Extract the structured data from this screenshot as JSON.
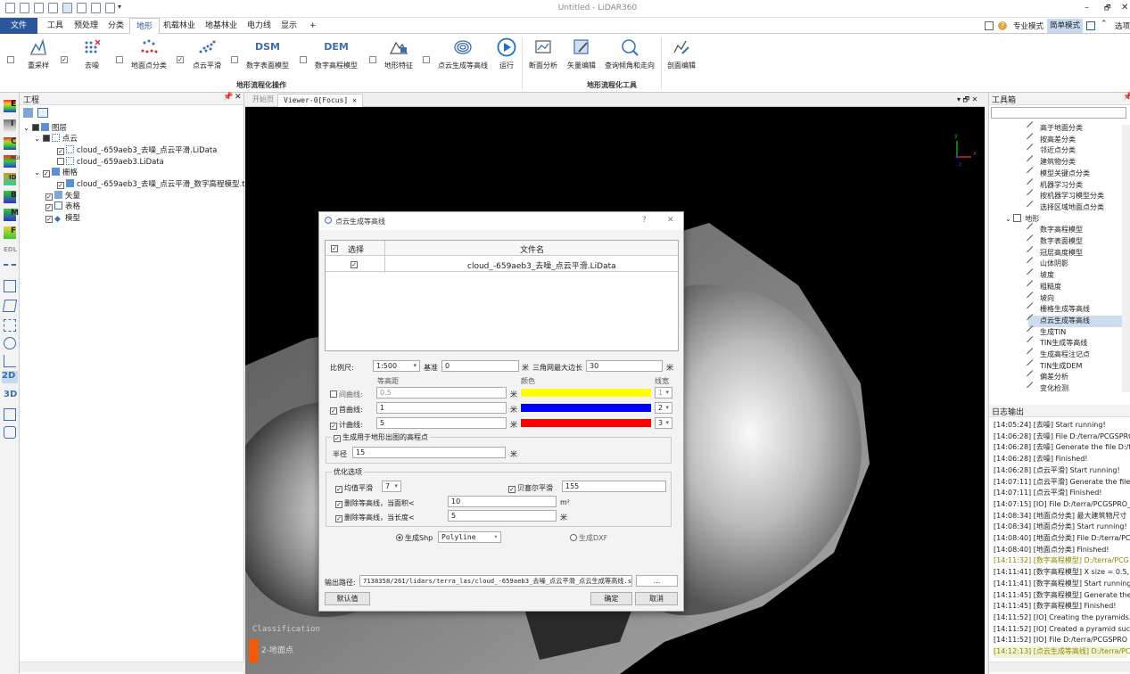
{
  "app": {
    "title": "Untitled - LiDAR360"
  },
  "menu": [
    "文件",
    "工具",
    "预处理",
    "分类",
    "地形",
    "机载林业",
    "地基林业",
    "电力线",
    "显示",
    "+"
  ],
  "mode": {
    "pro": "专业模式",
    "simple": "简单模式",
    "options": "选项"
  },
  "ribbon": {
    "items": [
      "重采样",
      "去噪",
      "地面点分类",
      "点云平滑",
      "数字表面模型",
      "数字高程模型",
      "地形特征",
      "点云生成等高线",
      "运行",
      "断面分析",
      "矢量编辑",
      "查询倾角和走向",
      "剖面编辑"
    ],
    "dsm_text": "DSM",
    "dem_text": "DEM",
    "group1": "地形流程化操作",
    "group2": "地形流程化工具"
  },
  "left_strip": [
    "E",
    "I",
    "C",
    "RGB",
    "ID",
    "B",
    "M",
    "F",
    "EDL",
    "2D",
    "3D"
  ],
  "project": {
    "title": "工程",
    "tree": [
      {
        "label": "图层"
      },
      {
        "label": "点云"
      },
      {
        "label": "cloud_-659aeb3_去噪_点云平滑.LiData"
      },
      {
        "label": "cloud_-659aeb3.LiData"
      },
      {
        "label": "栅格"
      },
      {
        "label": "cloud_-659aeb3_去噪_点云平滑_数字高程模型.tif"
      },
      {
        "label": "矢量"
      },
      {
        "label": "表格"
      },
      {
        "label": "模型"
      }
    ]
  },
  "viewer": {
    "tab_start": "开始页",
    "tab_viewer": "Viewer-0[Focus]",
    "classification_title": "Classification",
    "classification_item": "2-地面点",
    "axis_y": "y",
    "axis_x": "x",
    "axis_z": "z"
  },
  "toolbox": {
    "title": "工具箱",
    "items": [
      "高于地面分类",
      "按高差分类",
      "邻近点分类",
      "建筑物分类",
      "模型关键点分类",
      "机器学习分类",
      "按机器学习模型分类",
      "选择区域地面点分类"
    ],
    "group": "地形",
    "terrain_items": [
      "数字高程模型",
      "数字表面模型",
      "冠层高度模型",
      "山体阴影",
      "坡度",
      "粗糙度",
      "坡向",
      "栅格生成等高线",
      "点云生成等高线",
      "生成TIN",
      "TIN生成等高线",
      "生成高程注记点",
      "TIN生成DEM",
      "偏差分析",
      "变化检测"
    ]
  },
  "log": {
    "title": "日志输出",
    "lines": [
      "[14:05:24] [去噪]    Start running!",
      "[14:06:28] [去噪]    File D:/terra/PCGSPRO",
      "[14:06:28] [去噪]    Generate the file D:/te",
      "[14:06:28] [去噪]    Finished!",
      "[14:06:28] [点云平滑]    Start running!",
      "[14:07:11] [点云平滑]    Generate the file",
      "[14:07:11] [点云平滑]    Finished!",
      "[14:07:15] [IO]    File D:/terra/PCGSPRO_",
      "[14:08:34] [地面点分类]    最大建筑物尺寸",
      "[14:08:34] [地面点分类]    Start running!",
      "[14:08:40] [地面点分类]    File D:/terra/PC",
      "[14:08:40] [地面点分类]    Finished!",
      "[14:11:32] [数字高程模型]    D:/terra/PCG",
      "[14:11:41] [数字高程模型]    X size = 0.5,",
      "[14:11:41] [数字高程模型]    Start running",
      "[14:11:45] [数字高程模型]    Generate the",
      "[14:11:45] [数字高程模型]    Finished!",
      "[14:11:52] [IO]    Creating the pyramids.",
      "[14:11:52] [IO]    Created a pyramid suc",
      "[14:11:52] [IO]    File D:/terra/PCGSPRO",
      "[14:12:13] [点云生成等高线]    D:/terra/PC"
    ]
  },
  "dialog": {
    "title": "点云生成等高线",
    "help": "?",
    "close": "✕",
    "col_select": "选择",
    "col_filename": "文件名",
    "file": "cloud_-659aeb3_去噪_点云平滑.LiData",
    "scale_label": "比例尺:",
    "scale_value": "1:500",
    "base_label": "基准",
    "base_value": "0",
    "unit_m": "米",
    "tri_label": "三角网最大边长",
    "tri_value": "30",
    "col_interval": "等高距",
    "col_color": "颜色",
    "col_width": "线宽",
    "intermediate_label": "间曲线:",
    "intermediate_value": "0.5",
    "intermediate_width": "1",
    "first_label": "首曲线:",
    "first_value": "1",
    "first_width": "2",
    "index_label": "计曲线:",
    "index_value": "5",
    "index_width": "3",
    "colors": {
      "intermediate": "#ffff00",
      "first": "#0000ff",
      "index": "#ff0000"
    },
    "elev_group": "生成用于地形出图的高程点",
    "radius_label": "半径",
    "radius_value": "15",
    "opt_group": "优化选项",
    "mean_label": "均值平滑",
    "mean_value": "7",
    "bezier_label": "贝塞尔平滑",
    "bezier_value": "155",
    "del_area_label": "删除等高线，当面积<",
    "del_area_value": "10",
    "area_unit": "m²",
    "del_len_label": "删除等高线，当长度<",
    "del_len_value": "5",
    "shp_label": "生成Shp",
    "shp_type": "Polyline",
    "dxf_label": "生成DXF",
    "output_label": "输出路径:",
    "output_value": "7138358/261/lidars/terra_las/cloud_-659aeb3_去噪_点云平滑_点云生成等高线.shp",
    "browse": "...",
    "default_btn": "默认值",
    "ok_btn": "确定",
    "cancel_btn": "取消"
  }
}
